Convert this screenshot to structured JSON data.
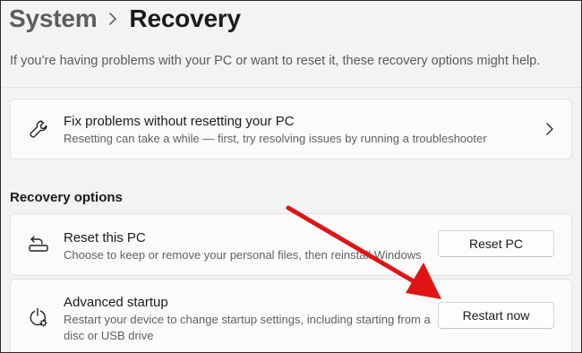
{
  "breadcrumb": {
    "parent": "System",
    "current": "Recovery"
  },
  "subtitle": "If you’re having problems with your PC or want to reset it, these recovery options might help.",
  "fix_card": {
    "title": "Fix problems without resetting your PC",
    "description": "Resetting can take a while — first, try resolving issues by running a troubleshooter"
  },
  "section_title": "Recovery options",
  "reset_card": {
    "title": "Reset this PC",
    "description": "Choose to keep or remove your personal files, then reinstall Windows",
    "button": "Reset PC"
  },
  "advanced_card": {
    "title": "Advanced startup",
    "description_line1": "Restart your device to change startup settings, including starting from a",
    "description_line2": "disc or USB drive",
    "button": "Restart now"
  },
  "colors": {
    "background": "#f3f3f3",
    "card": "#fbfbfb",
    "annotation_arrow": "#e01414"
  },
  "icons": {
    "breadcrumb_separator": "chevron-right-icon",
    "fix": "wrench-icon",
    "fix_navigate": "chevron-right-icon",
    "reset": "reset-pc-icon",
    "advanced": "advanced-startup-icon"
  }
}
